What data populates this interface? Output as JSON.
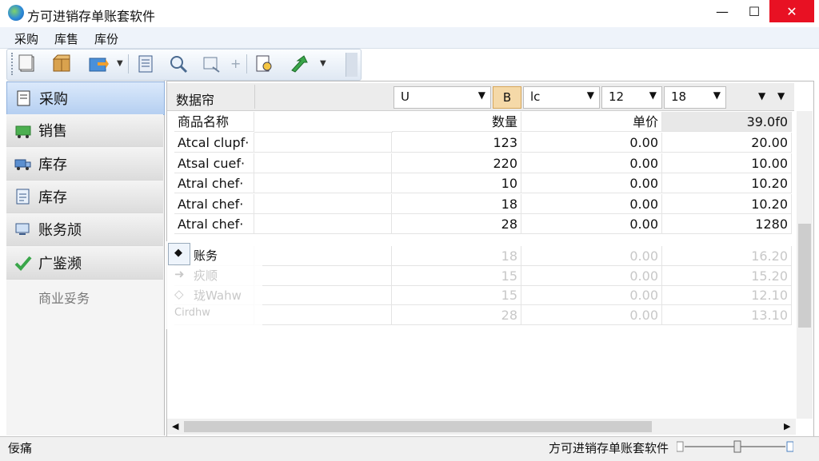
{
  "window": {
    "title": "方可进销存单账套软件",
    "min": "—",
    "max": "☐",
    "close": "✕"
  },
  "menu": [
    "采购",
    "库售",
    "库份"
  ],
  "sidebar": {
    "items": [
      {
        "label": "采购",
        "icon": "document-icon",
        "active": true
      },
      {
        "label": "销售",
        "icon": "cart-icon",
        "active": false
      },
      {
        "label": "库存",
        "icon": "truck-icon",
        "active": false
      },
      {
        "label": "库存",
        "icon": "report-icon",
        "active": false
      },
      {
        "label": "账务颃",
        "icon": "computer-icon",
        "active": false
      },
      {
        "label": "广鉴濒",
        "icon": "checkmark-icon",
        "active": false
      }
    ],
    "sub_item": "商业妥务"
  },
  "grid_toolbar": {
    "field_label": "数据帘",
    "combo1": "U",
    "bold_btn": "B",
    "combo2": "lc",
    "combo3": "12",
    "combo4": "18"
  },
  "table": {
    "headers": [
      "商品名称",
      "数量",
      "单价",
      "39.0f0"
    ],
    "rows": [
      [
        "Atcal clupf·",
        "123",
        "0.00",
        "20.00"
      ],
      [
        "Atsal cuef·",
        "220",
        "0.00",
        "10.00"
      ],
      [
        "Atral chef·",
        "10",
        "0.00",
        "10.20"
      ],
      [
        "Atral chef·",
        "18",
        "0.00",
        "10.20"
      ],
      [
        "Atral chef·",
        "28",
        "0.00",
        "1280"
      ]
    ],
    "faded_rows": [
      [
        "",
        "18",
        "0.00",
        "16.20"
      ],
      [
        "",
        "15",
        "0.00",
        "15.20"
      ],
      [
        "",
        "15",
        "0.00",
        "12.10"
      ],
      [
        "",
        "28",
        "0.00",
        "13.10"
      ]
    ]
  },
  "popup": {
    "items": [
      "账务",
      "疢顺",
      "珑Wahw",
      "Cirdhw"
    ]
  },
  "status": {
    "left": "佞痛",
    "right": "方可进销存单账套软件"
  }
}
